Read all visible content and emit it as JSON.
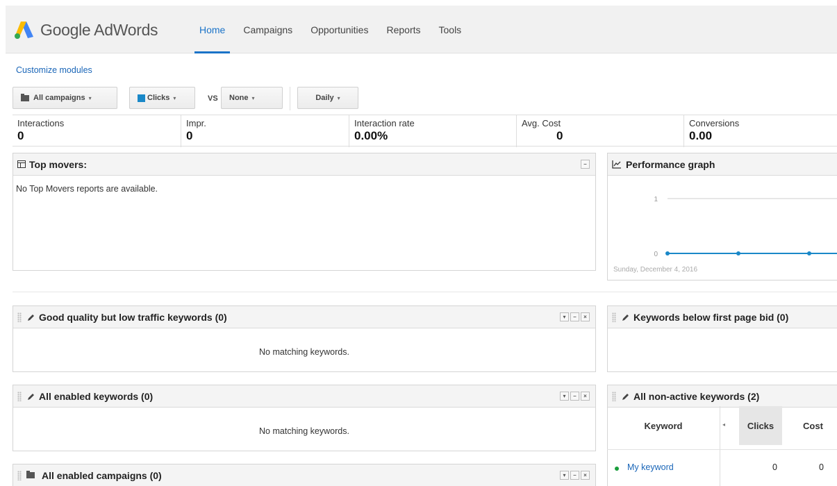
{
  "brand": {
    "name": "Google AdWords",
    "colors": {
      "blue": "#4285f4",
      "yellow": "#fbbc05",
      "green": "#34a853"
    }
  },
  "nav": {
    "items": [
      {
        "label": "Home",
        "active": true
      },
      {
        "label": "Campaigns"
      },
      {
        "label": "Opportunities"
      },
      {
        "label": "Reports"
      },
      {
        "label": "Tools"
      }
    ]
  },
  "customize_link": "Customize modules",
  "toolbar": {
    "campaigns_label": "All campaigns",
    "metric1_label": "Clicks",
    "metric1_color": "#1a88c8",
    "vs_label": "VS",
    "metric2_label": "None",
    "period_label": "Daily"
  },
  "stats": [
    {
      "label": "Interactions",
      "value": "0"
    },
    {
      "label": "Impr.",
      "value": "0"
    },
    {
      "label": "Interaction rate",
      "value": "0.00%"
    },
    {
      "label": "Avg. Cost",
      "value": "0"
    },
    {
      "label": "Conversions",
      "value": "0.00"
    }
  ],
  "top_movers": {
    "title": "Top movers:",
    "message": "No Top Movers reports are available."
  },
  "performance_graph": {
    "title": "Performance graph",
    "date_label": "Sunday, December 4, 2016",
    "series_color": "#1a88c8"
  },
  "chart_data": {
    "type": "line",
    "x": [
      "Sunday, December 4, 2016",
      "",
      ""
    ],
    "series": [
      {
        "name": "Clicks",
        "values": [
          0,
          0,
          0
        ]
      }
    ],
    "ylim": [
      0,
      1
    ],
    "ytick_labels": [
      "0",
      "1"
    ],
    "grid": true
  },
  "modules": {
    "good_quality": {
      "title": "Good quality but low traffic keywords (0)",
      "message": "No matching keywords."
    },
    "below_bid": {
      "title": "Keywords below first page bid (0)"
    },
    "all_enabled_kw": {
      "title": "All enabled keywords (0)",
      "message": "No matching keywords."
    },
    "all_enabled_campaigns": {
      "title": "All enabled campaigns (0)"
    },
    "non_active": {
      "title": "All non-active keywords (2)",
      "columns": {
        "keyword": "Keyword",
        "clicks": "Clicks",
        "cost": "Cost"
      },
      "rows": [
        {
          "keyword": "My keyword",
          "clicks": "0",
          "cost": "0",
          "status_color": "#1a9e3c"
        }
      ]
    }
  },
  "controls": {
    "dropdown": "▾",
    "minimize": "–",
    "close": "×",
    "collapse_left": "◂"
  }
}
